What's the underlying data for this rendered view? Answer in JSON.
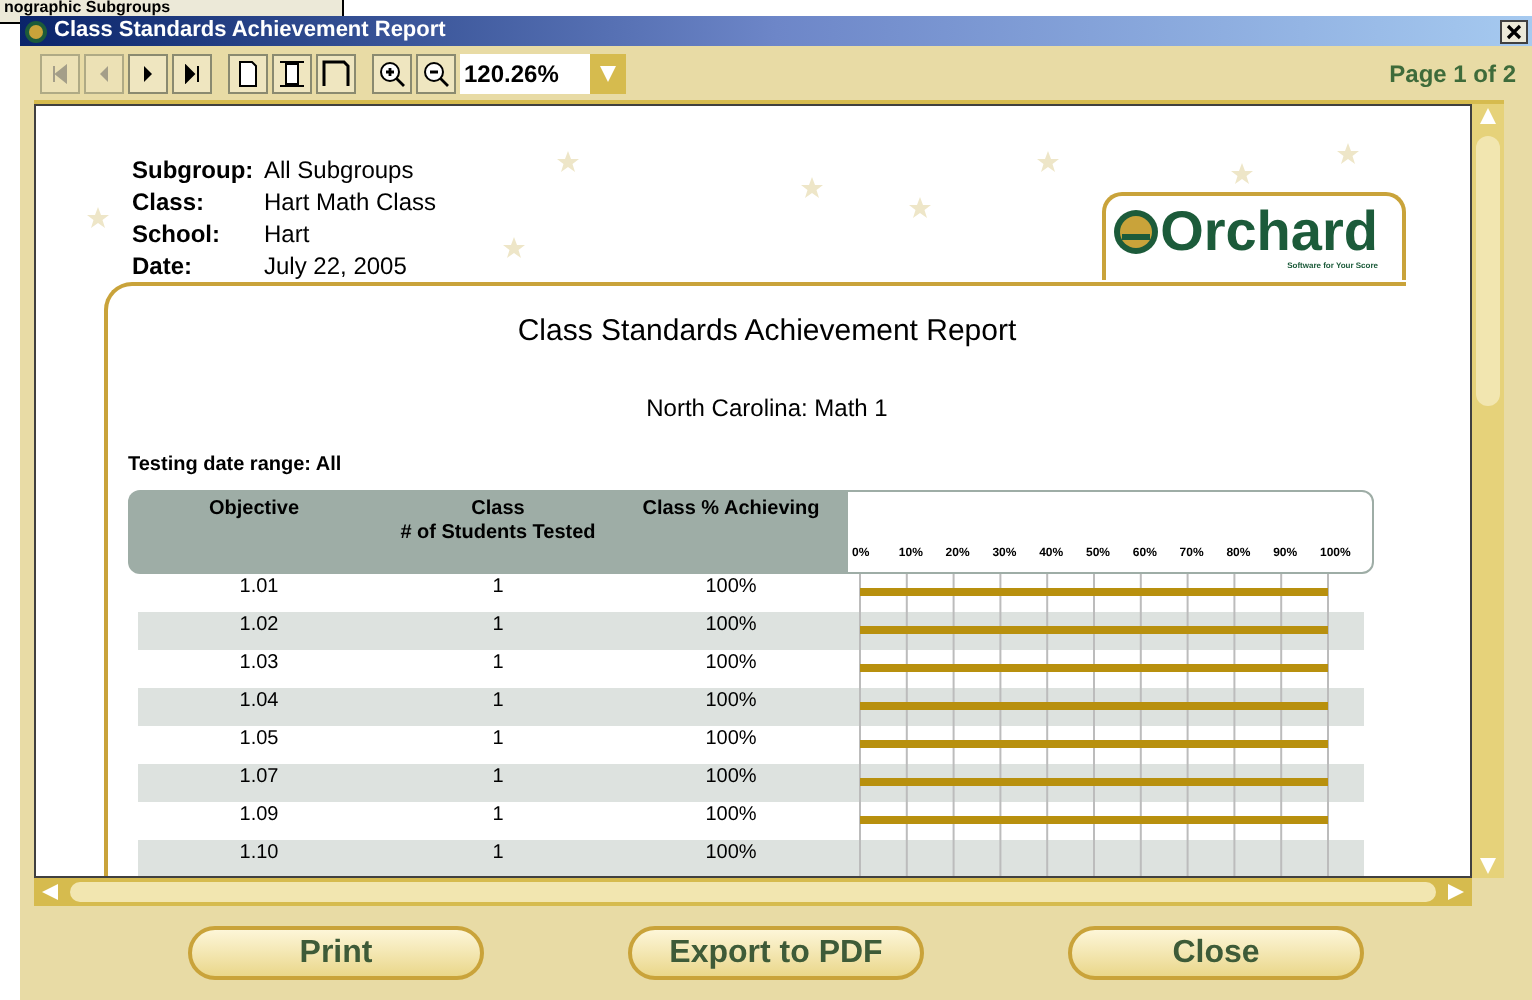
{
  "background_window": {
    "title": "nographic Subgroups"
  },
  "window": {
    "title": "Class Standards Achievement Report"
  },
  "toolbar": {
    "zoom": "120.26%",
    "page_indicator": "Page 1 of 2"
  },
  "report": {
    "info": [
      {
        "label": "Subgroup:",
        "value": "All Subgroups"
      },
      {
        "label": "Class:",
        "value": "Hart Math Class"
      },
      {
        "label": "School:",
        "value": "Hart"
      },
      {
        "label": "Date:",
        "value": "July 22, 2005"
      }
    ],
    "logo": {
      "name": "Orchard",
      "tagline": "Software for Your Score"
    },
    "title": "Class Standards Achievement Report",
    "subtitle": "North Carolina: Math 1",
    "date_range": "Testing date range: All",
    "table": {
      "columns": [
        "Objective",
        "Class\n# of Students Tested",
        "Class % Achieving"
      ],
      "rows": [
        {
          "objective": "1.01",
          "tested": "1",
          "achieving": "100%"
        },
        {
          "objective": "1.02",
          "tested": "1",
          "achieving": "100%"
        },
        {
          "objective": "1.03",
          "tested": "1",
          "achieving": "100%"
        },
        {
          "objective": "1.04",
          "tested": "1",
          "achieving": "100%"
        },
        {
          "objective": "1.05",
          "tested": "1",
          "achieving": "100%"
        },
        {
          "objective": "1.07",
          "tested": "1",
          "achieving": "100%"
        },
        {
          "objective": "1.09",
          "tested": "1",
          "achieving": "100%"
        },
        {
          "objective": "1.10",
          "tested": "1",
          "achieving": "100%"
        }
      ],
      "chart_data": {
        "type": "bar",
        "orientation": "horizontal",
        "grid": true,
        "values": [
          100,
          100,
          100,
          100,
          100,
          100,
          100
        ],
        "xlim": [
          0,
          100
        ],
        "xticks": [
          {
            "value": 0,
            "label": "0%"
          },
          {
            "value": 10,
            "label": "10%"
          },
          {
            "value": 20,
            "label": "20%"
          },
          {
            "value": 30,
            "label": "30%"
          },
          {
            "value": 40,
            "label": "40%"
          },
          {
            "value": 50,
            "label": "50%"
          },
          {
            "value": 60,
            "label": "60%"
          },
          {
            "value": 70,
            "label": "70%"
          },
          {
            "value": 80,
            "label": "80%"
          },
          {
            "value": 90,
            "label": "90%"
          },
          {
            "value": 100,
            "label": "100%"
          }
        ]
      }
    }
  },
  "buttons": [
    "Print",
    "Export to PDF",
    "Close"
  ]
}
